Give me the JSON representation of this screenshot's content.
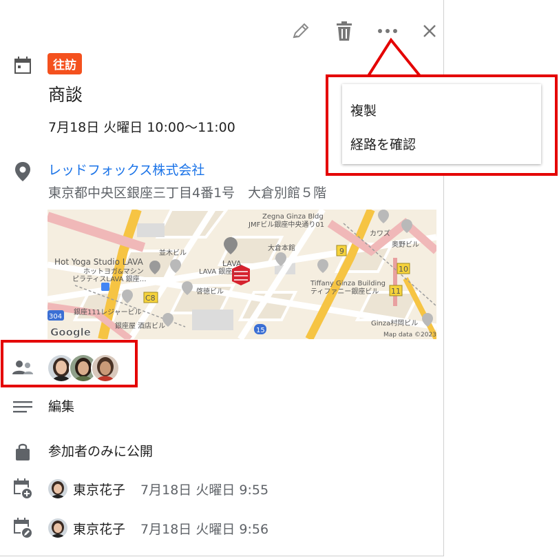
{
  "event": {
    "category_badge": "往訪",
    "title": "商談",
    "datetime": "7月18日 火曜日 10:00〜11:00",
    "location_name": "レッドフォックス株式会社",
    "location_address": "東京都中央区銀座三丁目4番1号　大倉別館５階",
    "description": "編集",
    "visibility": "参加者のみに公開",
    "created": {
      "name": "東京花子",
      "timestamp": "7月18日 火曜日 9:55"
    },
    "updated": {
      "name": "東京花子",
      "timestamp": "7月18日 火曜日 9:56"
    },
    "participants_count": 3
  },
  "toolbar": {
    "edit_icon": "pencil-icon",
    "delete_icon": "trash-icon",
    "more_icon": "more-horiz-icon",
    "close_icon": "close-icon"
  },
  "more_menu": {
    "items": [
      {
        "label": "複製"
      },
      {
        "label": "経路を確認"
      }
    ]
  },
  "map": {
    "labels": {
      "zegna": "Zegna Ginza Bldg",
      "jmf": "JMFビル銀座中央通り01",
      "kawazu": "カワズ",
      "okuno": "奥野ビル",
      "namiki": "並木ビル",
      "okura": "大倉本館",
      "hotyoga": "Hot Yoga Studio LAVA",
      "hotyoga_sub1": "ホットヨガ&マシン",
      "hotyoga_sub2": "ピラティスLAVA 銀座…",
      "lava": "LAVA",
      "lava_sub": "LAVA 銀座…",
      "keitoku": "啓徳ビル",
      "tiffany": "Tiffany Ginza Building",
      "tiffany_sub": "ティファニー銀座ビル",
      "ginza111": "銀座111レジャービル",
      "ginzaya": "銀座屋 酒店ビル",
      "ginzamura": "Ginza村岡ビル",
      "google": "Google",
      "mapdata": "Map data ©2023",
      "route_c8": "C8",
      "route_9": "9",
      "route_10": "10",
      "route_11": "11",
      "route_15": "15",
      "route_304": "304"
    }
  },
  "colors": {
    "accent_blue": "#1a73e8",
    "badge_orange": "#f4511e",
    "highlight_red": "#e40000"
  }
}
